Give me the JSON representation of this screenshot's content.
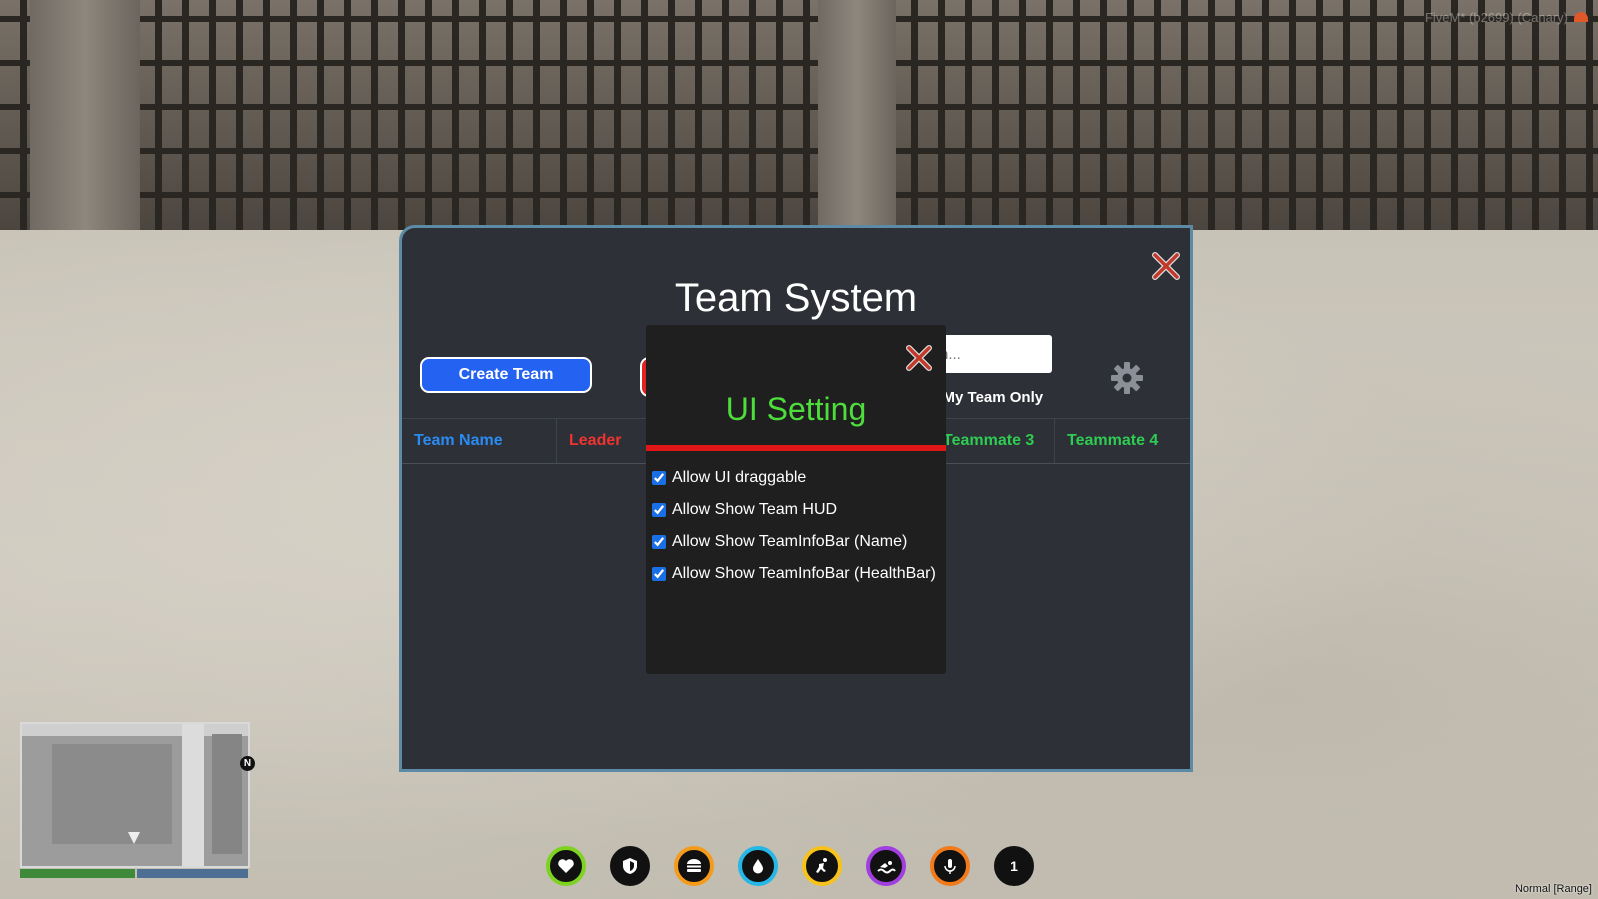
{
  "overlay": {
    "client_version": "FiveM* (b2699) (Canary)",
    "voice_mode": "Normal [Range]"
  },
  "minimap": {
    "north_label": "N",
    "health_fraction": 0.51,
    "armor_fraction": 1.0
  },
  "hud": {
    "icons": [
      "heart-icon",
      "shield-icon",
      "burger-icon",
      "water-drop-icon",
      "stamina-icon",
      "swim-icon",
      "microphone-icon",
      "level-badge"
    ],
    "badge_value": "1",
    "ring_colors": [
      "#7ed321",
      "#111111",
      "#f59b1b",
      "#25b7e6",
      "#f6c21b",
      "#a13ee0",
      "#f27a1a",
      "#111111"
    ]
  },
  "team_panel": {
    "title": "Team System",
    "create_button": "Create Team",
    "search_placeholder": "n...",
    "my_team_only_label": "y My Team Only",
    "columns": [
      {
        "label": "Team Name",
        "color": "#2a8bf2"
      },
      {
        "label": "Leader",
        "color": "#f0332f"
      },
      {
        "label": "",
        "color": "#2ecc52"
      },
      {
        "label": "",
        "color": "#2ecc52"
      },
      {
        "label": "Teammate 3",
        "color": "#2ecc52"
      },
      {
        "label": "Teammate 4",
        "color": "#2ecc52"
      }
    ]
  },
  "ui_setting_modal": {
    "title": "UI Setting",
    "options": [
      {
        "label": "Allow UI draggable",
        "checked": true
      },
      {
        "label": "Allow Show Team HUD",
        "checked": true
      },
      {
        "label": "Allow Show TeamInfoBar (Name)",
        "checked": true
      },
      {
        "label": "Allow Show TeamInfoBar (HealthBar)",
        "checked": true
      }
    ]
  },
  "colors": {
    "panel_bg": "#2d3037",
    "panel_border": "#5d8ba6",
    "accent_blue": "#2462f2",
    "modal_title": "#4ede3b",
    "modal_rule": "#e11616",
    "close_x": "#c0392b"
  }
}
